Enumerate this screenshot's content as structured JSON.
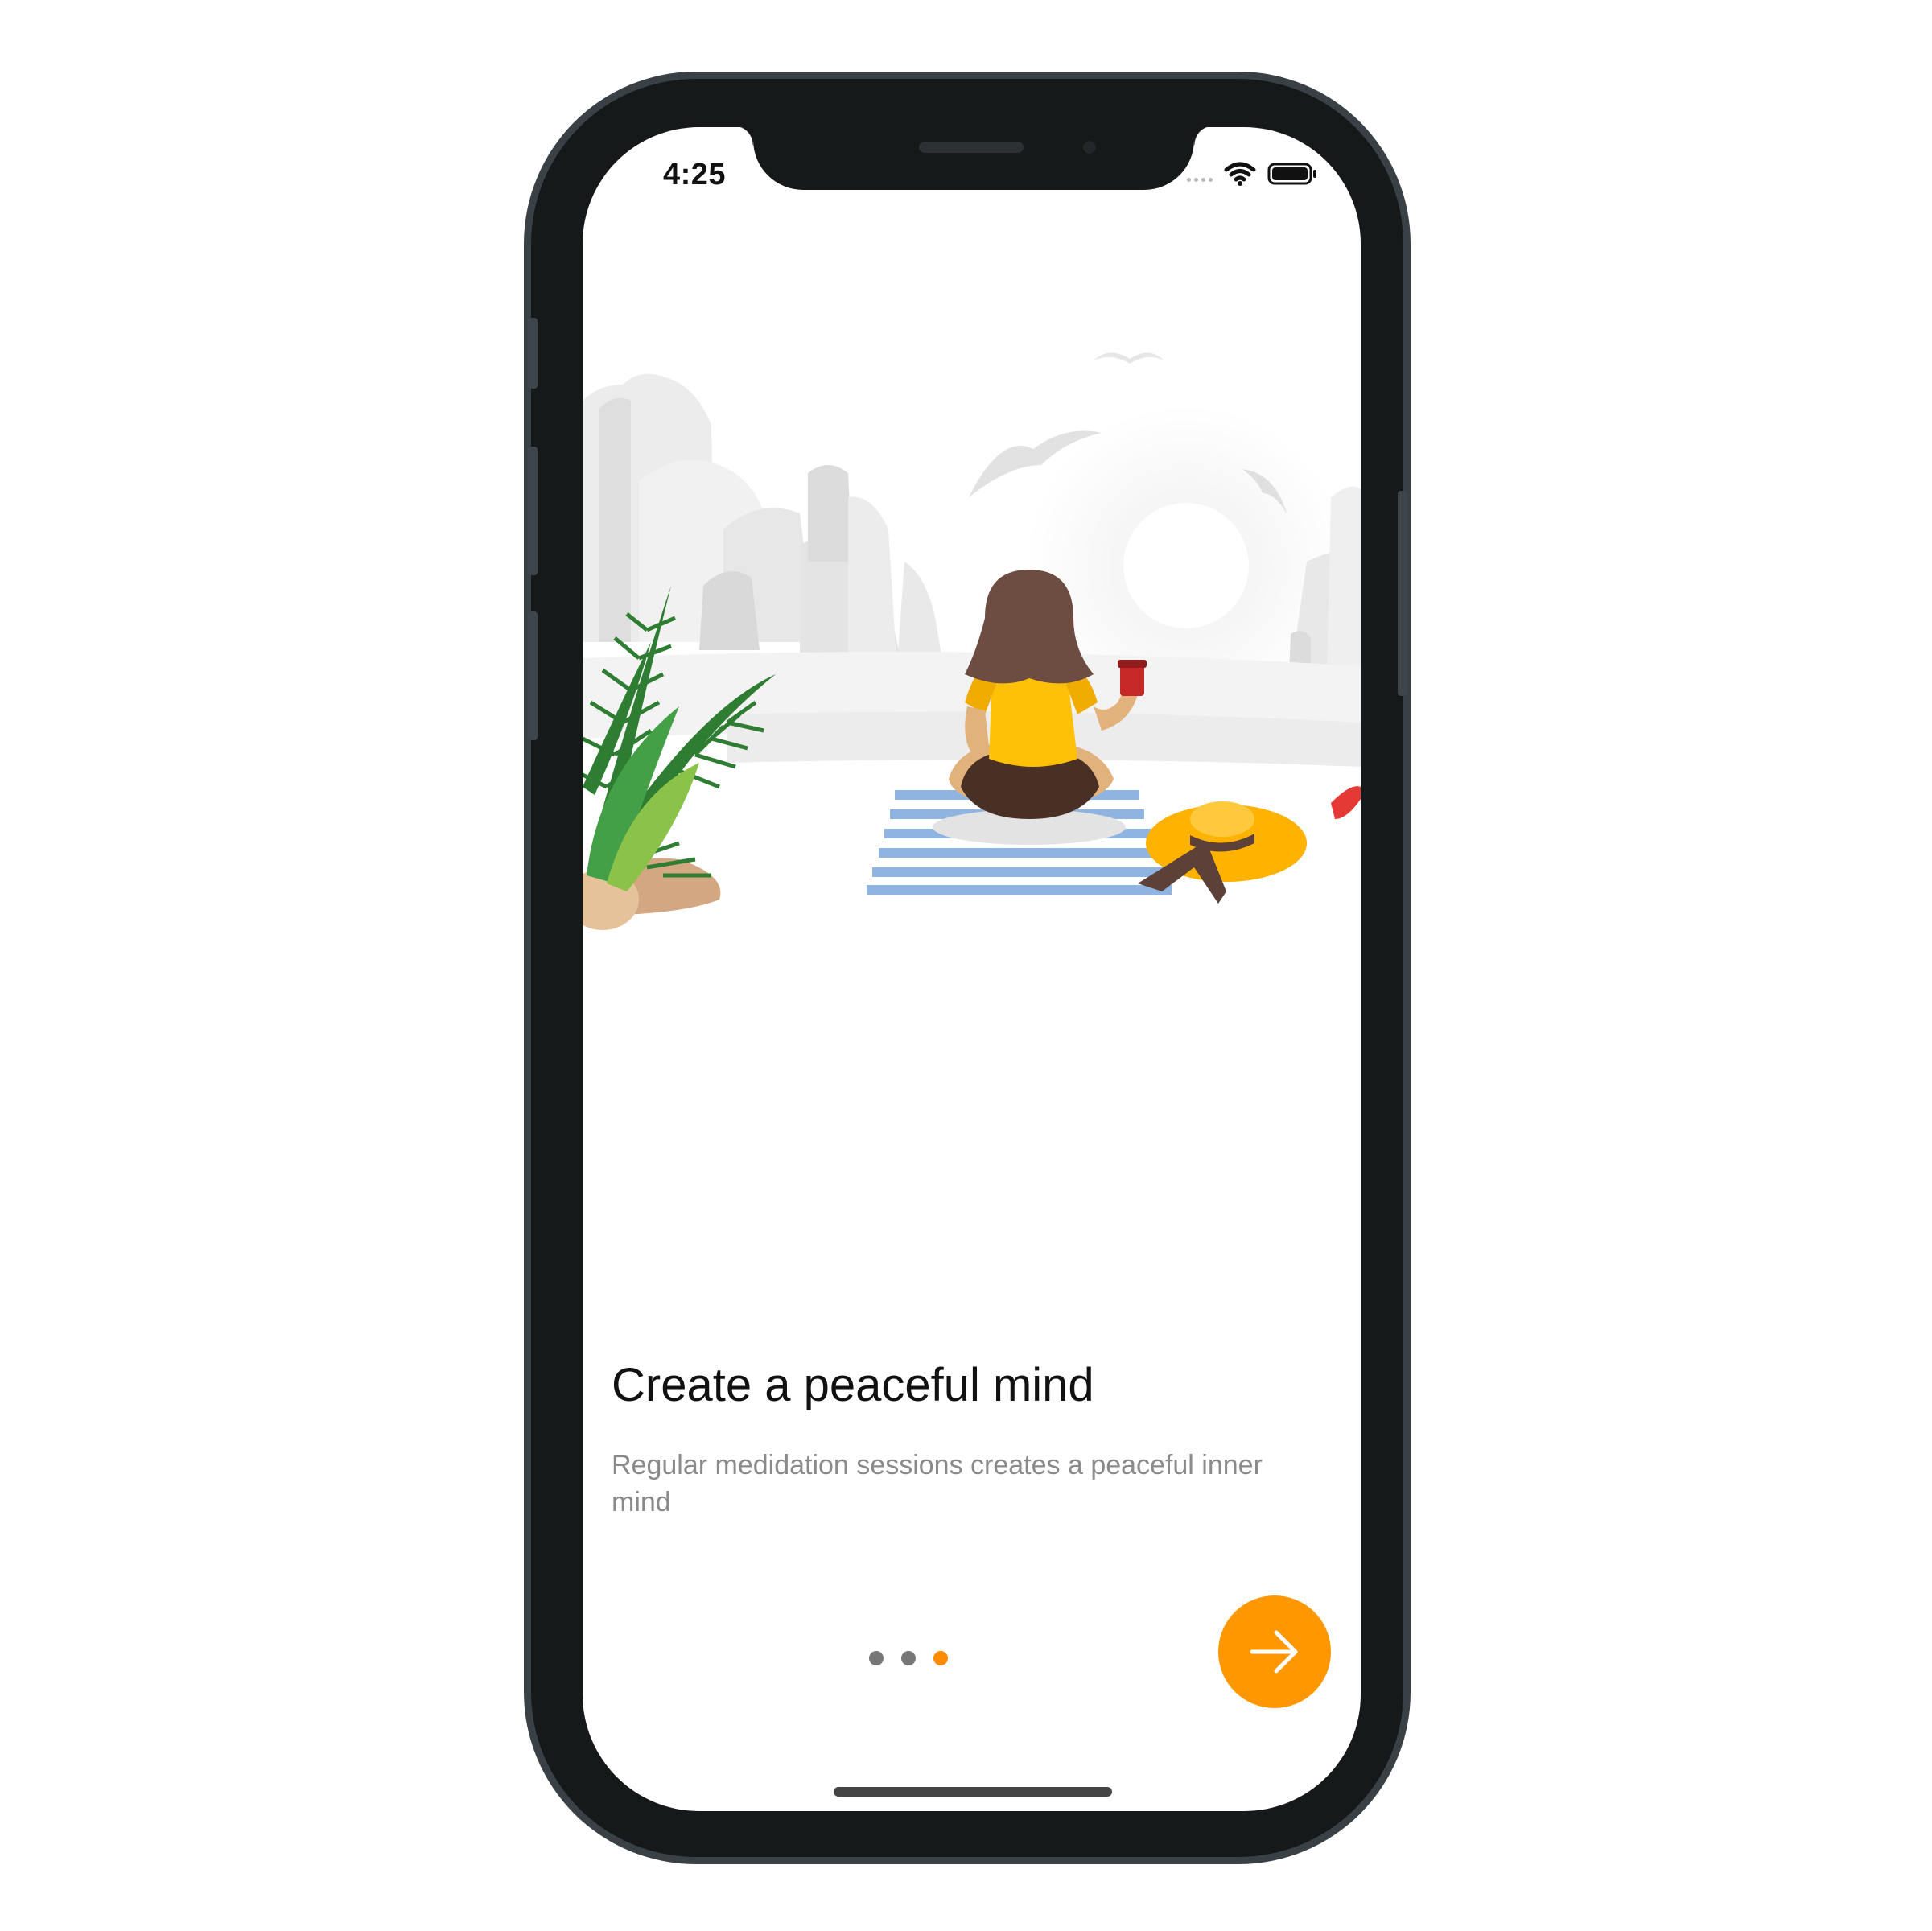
{
  "status_bar": {
    "time": "4:25"
  },
  "onboarding": {
    "title": "Create a peaceful mind",
    "subtitle": "Regular medidation sessions creates a peaceful inner mind",
    "page_indicator": {
      "total": 3,
      "current": 3
    },
    "next_icon": "arrow-right-icon"
  },
  "colors": {
    "accent": "#ff9800",
    "dot_active": "#ff8c00",
    "dot_inactive": "#777777",
    "title": "#111111",
    "subtitle": "#8a8a8a"
  }
}
